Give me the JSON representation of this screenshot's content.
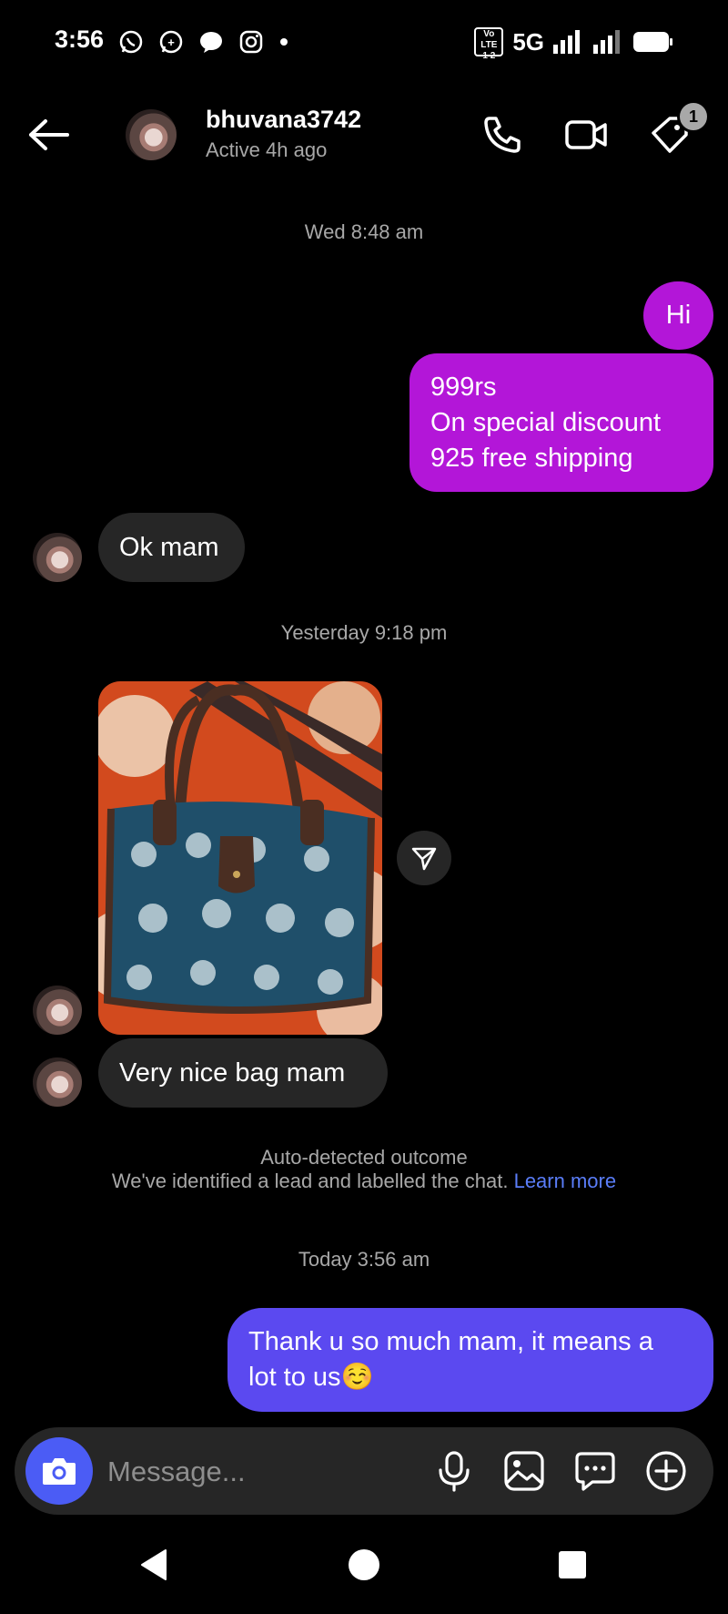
{
  "status_bar": {
    "time": "3:56",
    "network": "5G",
    "volte_label": "Vo LTE",
    "volte_sub": "1 2"
  },
  "header": {
    "username": "bhuvana3742",
    "activity": "Active 4h ago",
    "label_badge_count": "1"
  },
  "messages": {
    "ts1": "Wed 8:48 am",
    "out1": "Hi",
    "out2_line1": "999rs",
    "out2_line2": "On special discount",
    "out2_line3": "925 free shipping",
    "in1": "Ok mam",
    "ts2": "Yesterday 9:18 pm",
    "in2": "Very nice bag mam",
    "notice_title": "Auto-detected outcome",
    "notice_body": "We've identified a lead and labelled the chat.",
    "notice_link": "Learn more",
    "ts3": "Today 3:56 am",
    "out3_line1": "Thank u so much mam, it means a",
    "out3_line2": "lot to us☺️"
  },
  "composer": {
    "placeholder": "Message..."
  },
  "colors": {
    "outgoing_pink": "#b316d8",
    "outgoing_blue": "#5b49f0",
    "incoming": "#262626",
    "link": "#5a7df8",
    "camera_button": "#4b5cf5"
  },
  "icons": [
    "whatsapp-icon",
    "whatsapp-business-icon",
    "messenger-icon",
    "instagram-icon",
    "signal-icon",
    "battery-icon",
    "back-arrow-icon",
    "phone-icon",
    "video-icon",
    "label-tag-icon",
    "send-icon",
    "camera-icon",
    "microphone-icon",
    "gallery-icon",
    "sticker-chat-icon",
    "plus-icon",
    "nav-back-icon",
    "nav-home-icon",
    "nav-recents-icon"
  ]
}
